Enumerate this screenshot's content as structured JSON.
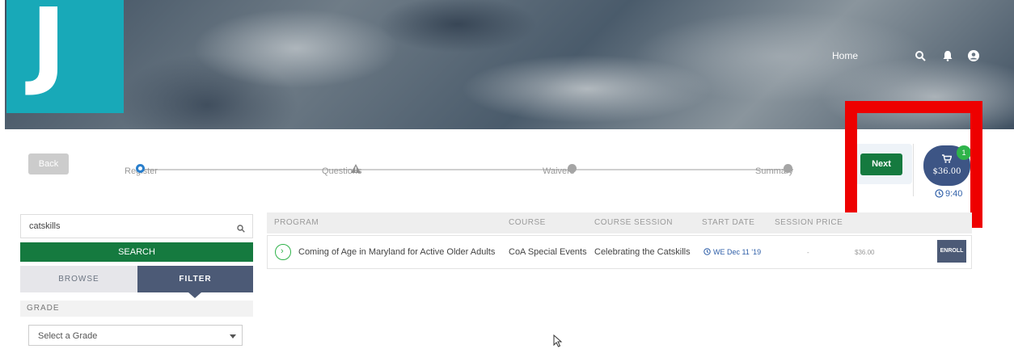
{
  "header": {
    "logo_letter": "J",
    "nav_home": "Home",
    "icons": [
      "search-icon",
      "bell-icon",
      "user-icon"
    ]
  },
  "steps": {
    "back_label": "Back",
    "items": [
      {
        "label": "Register",
        "icon": "circle-dot",
        "state": "active"
      },
      {
        "label": "Questions",
        "icon": "warning-triangle",
        "state": "warning"
      },
      {
        "label": "Waivers",
        "icon": "circle",
        "state": "pending"
      },
      {
        "label": "Summary",
        "icon": "circle",
        "state": "pending"
      }
    ],
    "next_label": "Next"
  },
  "cart": {
    "badge_count": "1",
    "total": "$36.00",
    "timer": "9:40",
    "icon": "cart-icon"
  },
  "search": {
    "value": "catskills",
    "button_label": "SEARCH"
  },
  "tabs": {
    "browse": "BROWSE",
    "filter": "FILTER",
    "active": "filter"
  },
  "filters": {
    "grade_label": "GRADE",
    "grade_placeholder": "Select a Grade"
  },
  "table": {
    "headers": {
      "program": "PROGRAM",
      "course": "COURSE",
      "course_session": "COURSE SESSION",
      "start_date": "START DATE",
      "session_price": "SESSION PRICE"
    },
    "rows": [
      {
        "program": "Coming of Age in Maryland for Active Older Adults",
        "course": "CoA Special Events",
        "course_session": "Celebrating the Catskills",
        "start_date": "WE Dec 11 '19",
        "session_price": "-",
        "price": "$36.00",
        "action": "ENROLL"
      }
    ]
  },
  "colors": {
    "accent_green": "#157a3f",
    "navy": "#4c5a76",
    "logo_teal": "#18a9b8",
    "highlight_red": "#ee0000"
  }
}
